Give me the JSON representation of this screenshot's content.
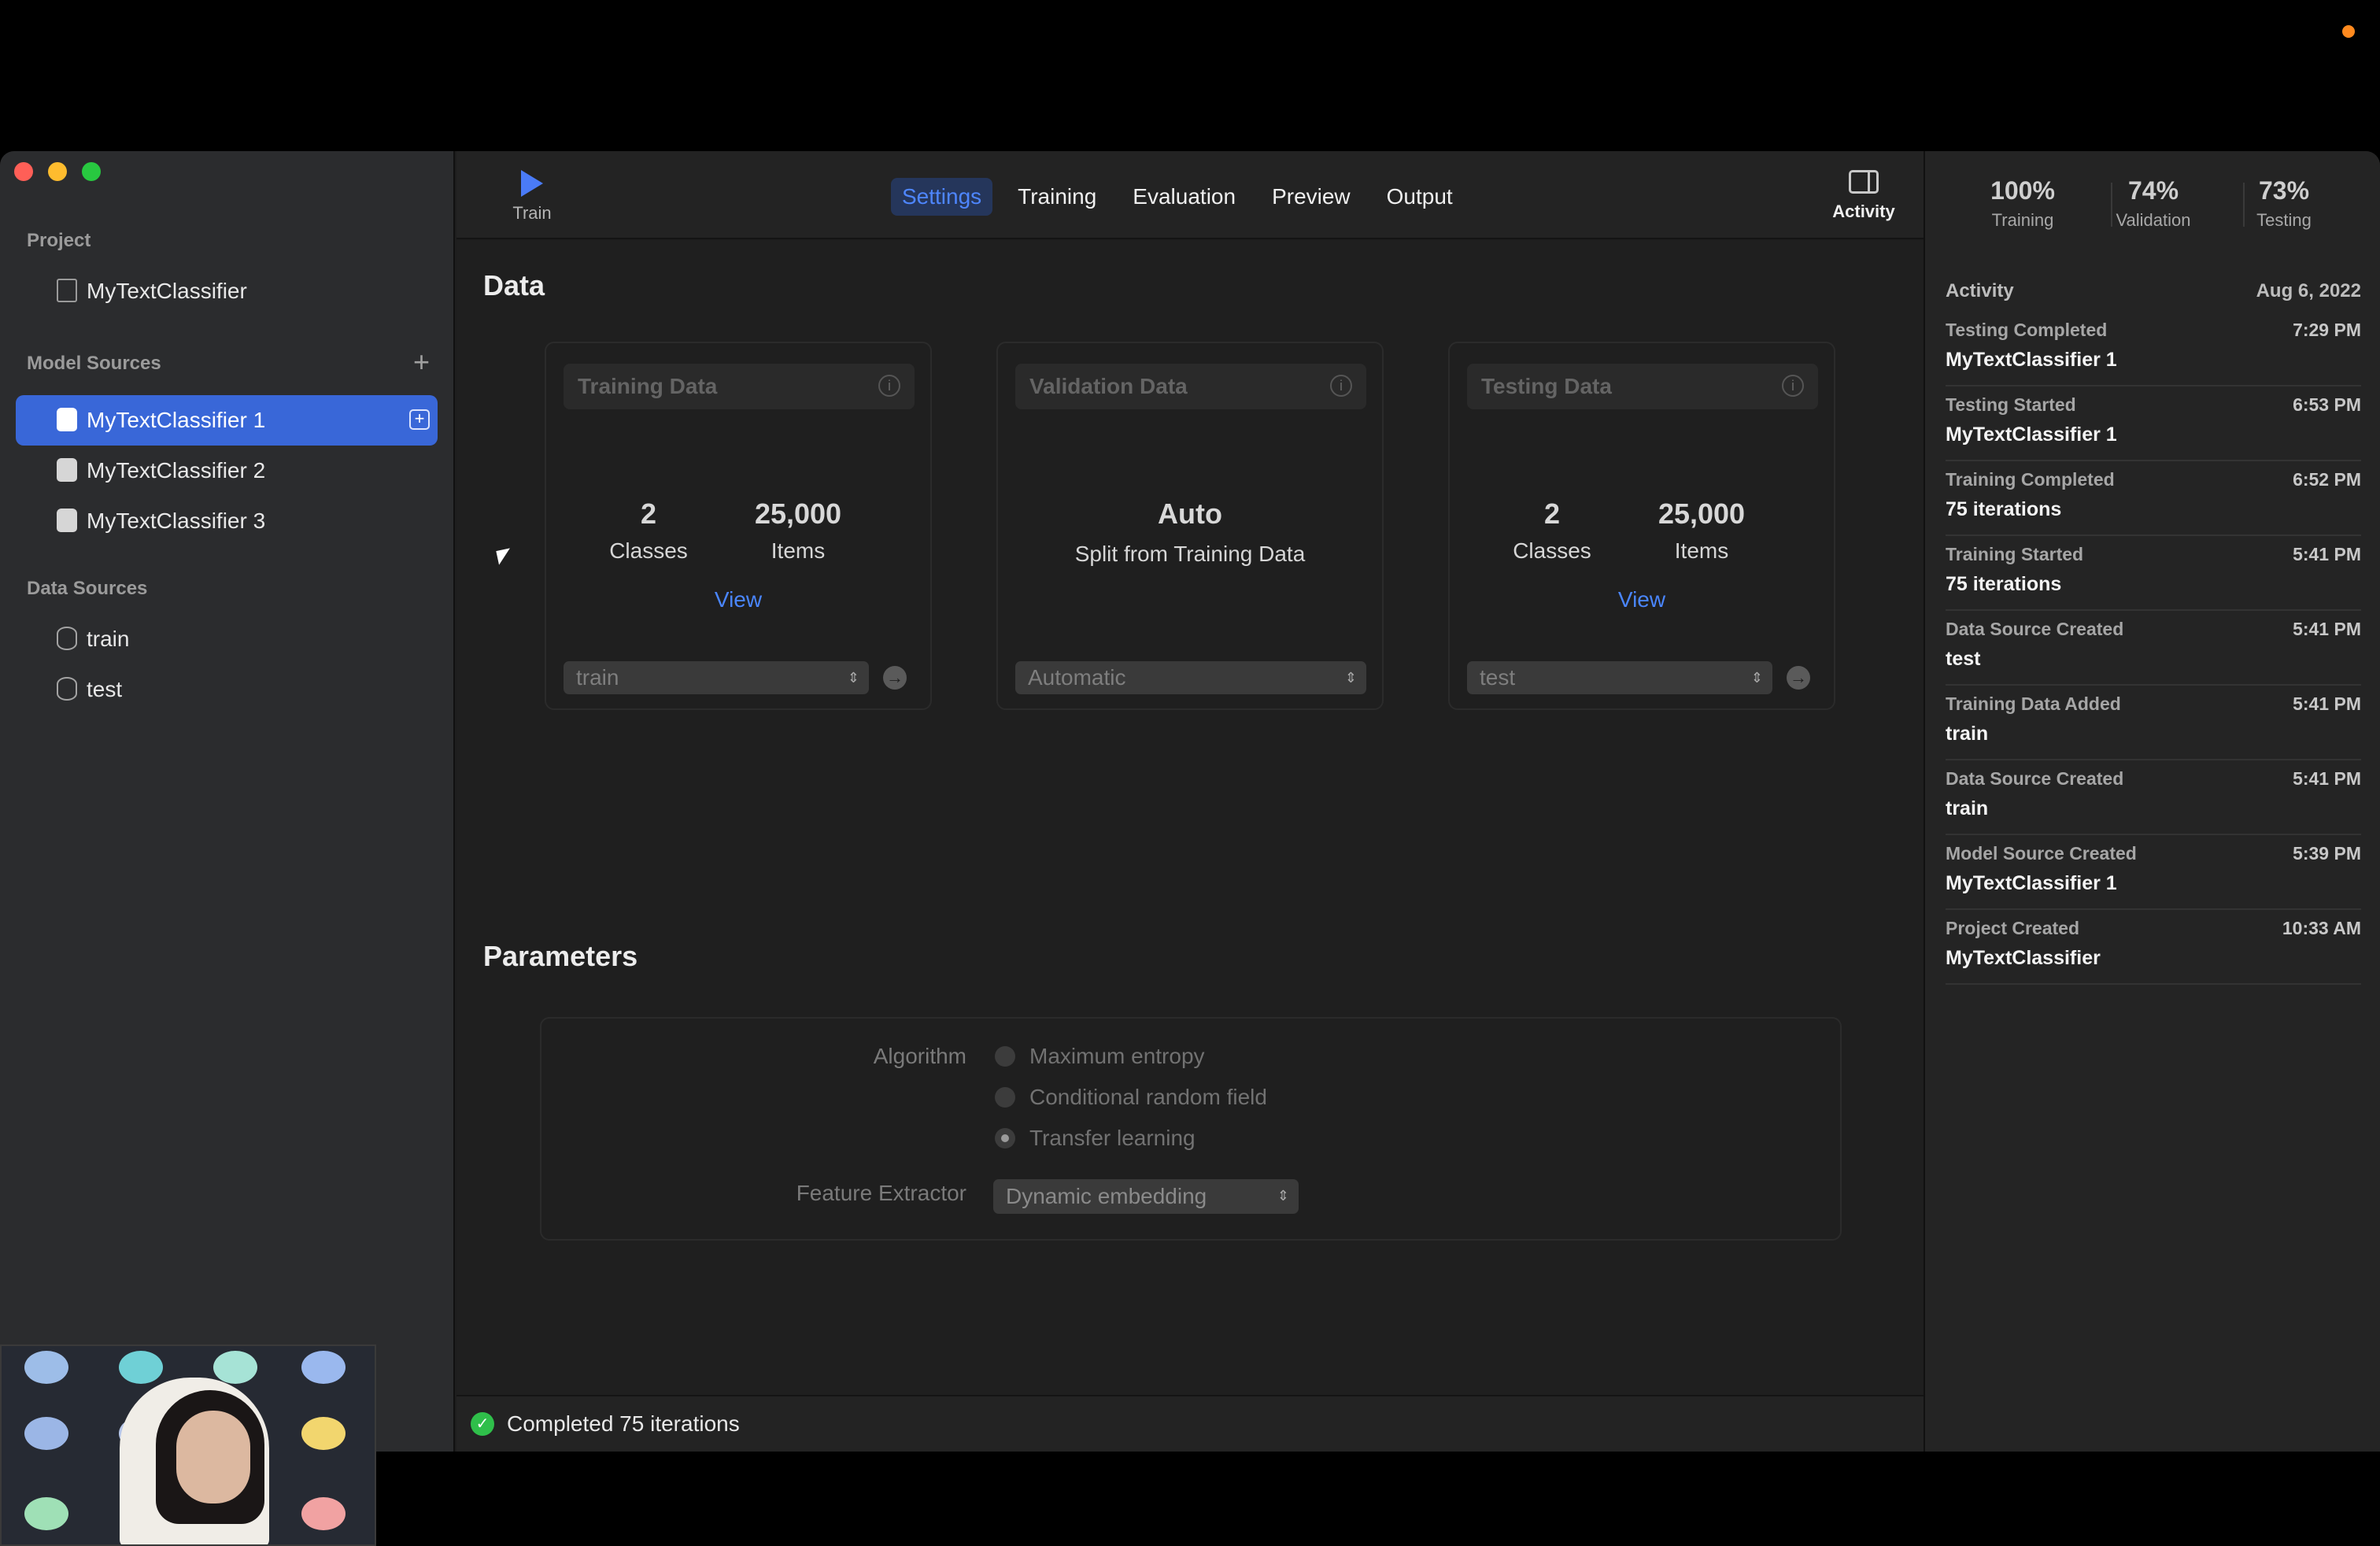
{
  "sidebar": {
    "project_label": "Project",
    "project_name": "MyTextClassifier",
    "model_sources_label": "Model Sources",
    "model_sources": [
      {
        "label": "MyTextClassifier 1",
        "selected": true
      },
      {
        "label": "MyTextClassifier 2",
        "selected": false
      },
      {
        "label": "MyTextClassifier 3",
        "selected": false
      }
    ],
    "data_sources_label": "Data Sources",
    "data_sources": [
      {
        "label": "train"
      },
      {
        "label": "test"
      }
    ]
  },
  "toolbar": {
    "train_label": "Train",
    "tabs": [
      {
        "label": "Settings",
        "active": true
      },
      {
        "label": "Training",
        "active": false
      },
      {
        "label": "Evaluation",
        "active": false
      },
      {
        "label": "Preview",
        "active": false
      },
      {
        "label": "Output",
        "active": false
      }
    ],
    "activity_label": "Activity"
  },
  "data_section": {
    "title": "Data",
    "training": {
      "header": "Training Data",
      "classes_value": "2",
      "classes_label": "Classes",
      "items_value": "25,000",
      "items_label": "Items",
      "view_link": "View",
      "source": "train"
    },
    "validation": {
      "header": "Validation Data",
      "value": "Auto",
      "subtitle": "Split from Training Data",
      "source": "Automatic"
    },
    "testing": {
      "header": "Testing Data",
      "classes_value": "2",
      "classes_label": "Classes",
      "items_value": "25,000",
      "items_label": "Items",
      "view_link": "View",
      "source": "test"
    }
  },
  "parameters": {
    "title": "Parameters",
    "algorithm_label": "Algorithm",
    "algorithm_options": [
      {
        "label": "Maximum entropy",
        "selected": false
      },
      {
        "label": "Conditional random field",
        "selected": false
      },
      {
        "label": "Transfer learning",
        "selected": true
      }
    ],
    "feature_extractor_label": "Feature Extractor",
    "feature_extractor_value": "Dynamic embedding"
  },
  "status_bar": {
    "message": "Completed 75 iterations"
  },
  "metrics": [
    {
      "value": "100%",
      "label": "Training"
    },
    {
      "value": "74%",
      "label": "Validation"
    },
    {
      "value": "73%",
      "label": "Testing"
    }
  ],
  "activity": {
    "title": "Activity",
    "date": "Aug 6, 2022",
    "events": [
      {
        "kind": "Testing Completed",
        "time": "7:29 PM",
        "detail": "MyTextClassifier 1"
      },
      {
        "kind": "Testing Started",
        "time": "6:53 PM",
        "detail": "MyTextClassifier 1"
      },
      {
        "kind": "Training Completed",
        "time": "6:52 PM",
        "detail": "75 iterations"
      },
      {
        "kind": "Training Started",
        "time": "5:41 PM",
        "detail": "75 iterations"
      },
      {
        "kind": "Data Source Created",
        "time": "5:41 PM",
        "detail": "test"
      },
      {
        "kind": "Training Data Added",
        "time": "5:41 PM",
        "detail": "train"
      },
      {
        "kind": "Data Source Created",
        "time": "5:41 PM",
        "detail": "train"
      },
      {
        "kind": "Model Source Created",
        "time": "5:39 PM",
        "detail": "MyTextClassifier 1"
      },
      {
        "kind": "Project Created",
        "time": "10:33 AM",
        "detail": "MyTextClassifier"
      }
    ]
  },
  "colors": {
    "accent": "#3967d8",
    "link": "#4a86ff",
    "success": "#2fbf4a",
    "recording_dot": "#ff8a1e"
  }
}
